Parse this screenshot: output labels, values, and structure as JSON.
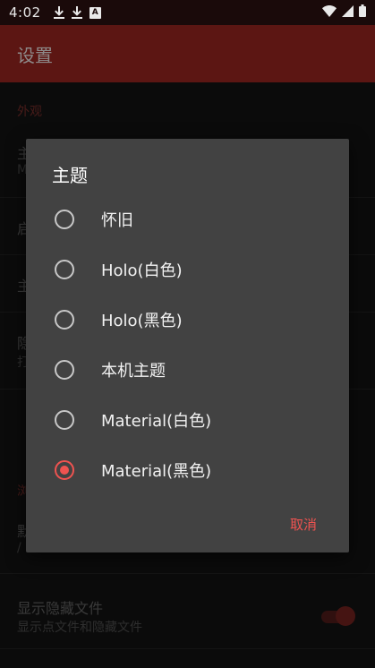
{
  "status_bar": {
    "time": "4:02",
    "left_icons": [
      "download-icon",
      "download-icon",
      "a-badge-icon"
    ],
    "right_icons": [
      "wifi-icon",
      "signal-icon",
      "battery-icon"
    ]
  },
  "app_bar": {
    "title": "设置"
  },
  "settings": {
    "section_appearance": "外观",
    "rows_partial": [
      {
        "title": "主",
        "subtitle": "M"
      },
      {
        "title": "启",
        "subtitle": ""
      },
      {
        "title": "主",
        "subtitle": ""
      },
      {
        "title": "隐",
        "subtitle": "打"
      }
    ],
    "section_browse": "浏",
    "default_dir": {
      "title": "默",
      "subtitle": "/"
    },
    "show_hidden": {
      "title": "显示隐藏文件",
      "subtitle": "显示点文件和隐藏文件",
      "enabled": true
    }
  },
  "dialog": {
    "title": "主题",
    "options": [
      {
        "label": "怀旧",
        "selected": false
      },
      {
        "label": "Holo(白色)",
        "selected": false
      },
      {
        "label": "Holo(黑色)",
        "selected": false
      },
      {
        "label": "本机主题",
        "selected": false
      },
      {
        "label": "Material(白色)",
        "selected": false
      },
      {
        "label": "Material(黑色)",
        "selected": true
      }
    ],
    "cancel_label": "取消"
  },
  "colors": {
    "accent": "#ef5350",
    "app_bar": "#5c1613",
    "dialog_bg": "#424242"
  }
}
